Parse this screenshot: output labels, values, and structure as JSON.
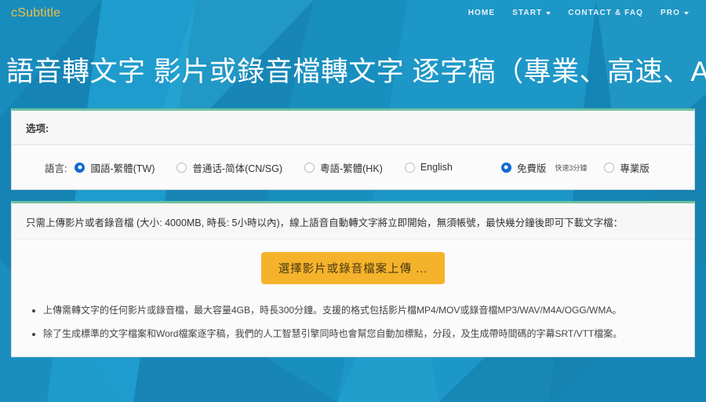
{
  "brand": {
    "name": "cSubtitle",
    "color": "#f0c040"
  },
  "nav": {
    "items": [
      {
        "label": "HOME",
        "caret": false
      },
      {
        "label": "START",
        "caret": true
      },
      {
        "label": "CONTACT & FAQ",
        "caret": false
      },
      {
        "label": "PRO",
        "caret": true
      }
    ]
  },
  "hero": {
    "title": "語音轉文字 影片或錄音檔轉文字 逐字稿（專業、高速、AI）"
  },
  "options_panel": {
    "header": "选项:",
    "language_label": "語言:",
    "languages": [
      {
        "label": "國語-繁體(TW)",
        "checked": true
      },
      {
        "label": "普通话-简体(CN/SG)",
        "checked": false
      },
      {
        "label": "粵語-繁體(HK)",
        "checked": false
      },
      {
        "label": "English",
        "checked": false
      }
    ],
    "plans": [
      {
        "label": "免費版",
        "sub": "快速3分鐘",
        "checked": true
      },
      {
        "label": "專業版",
        "sub": "",
        "checked": false
      }
    ]
  },
  "upload_panel": {
    "note": "只需上傳影片或者錄音檔 (大小: 4000MB, 時長: 5小時以內)，線上語音自動轉文字將立即開始，無須帳號，最快幾分鐘後即可下載文字檔：",
    "button_label": "選擇影片或錄音檔案上傳 ...",
    "button_color": "#f5b32c",
    "bullets": [
      "上傳需轉文字的任何影片或錄音檔，最大容量4GB，時長300分鐘。支援的格式包括影片檔MP4/MOV或錄音檔MP3/WAV/M4A/OGG/WMA。",
      "除了生成標準的文字檔案和Word檔案逐字稿，我們的人工智慧引擎同時也會幫您自動加標點，分段，及生成帶時間碼的字幕SRT/VTT檔案。"
    ]
  },
  "theme": {
    "background_blue": "#1a8fc1",
    "panel_accent": "#6cc1a0",
    "radio_accent": "#1269d3"
  }
}
